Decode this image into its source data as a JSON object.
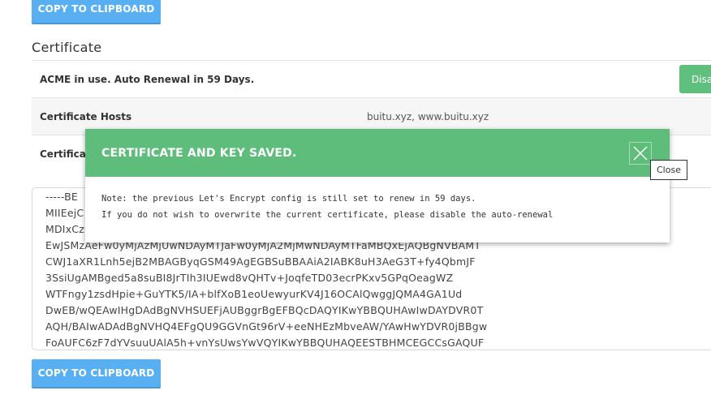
{
  "buttons": {
    "copy_top": "COPY TO CLIPBOARD",
    "copy_bottom": "COPY TO CLIPBOARD"
  },
  "certificate": {
    "section_title": "Certificate",
    "acme_status": "ACME in use. Auto Renewal in 59 Days.",
    "disable_button": "Disa",
    "hosts_label": "Certificate Hosts",
    "hosts_value": "buitu.xyz, www.buitu.xyz",
    "row3_label": "Certificat",
    "cert_lines": [
      "-----BE",
      "MIIEejC",
      "MDIxCz",
      "EwJSMzAeFw0yMjAzMjUwNDAyMTJaFw0yMjA2MjMwNDAyMTFaMBQxEjAQBgNVBAMT",
      "CWJ1aXR1Lnh5ejB2MBAGByqGSM49AgEGBSuBBAAiA2IABK8uH3AeG3T+fy4QbmJF",
      "3SsiUgAMBged5a8suBI8JrTIh3IUEwd8vQHTv+JoqfeTD03ecrPKxv5GPqOeagWZ",
      "WTFngy1zsdHpie+GuYTK5/IA+blfXoB1eoUewyurKV4J16OCAlQwggJQMA4GA1Ud",
      "DwEB/wQEAwIHgDAdBgNVHSUEFjAUBggrBgEFBQcDAQYIKwYBBQUHAwIwDAYDVR0T",
      "AQH/BAIwADAdBgNVHQ4EFgQU9GGVnGt96rV+eeNHEzMbveAW/YAwHwYDVR0jBBgw",
      "FoAUFC6zF7dYVsuuUAlA5h+vnYsUwsYwVQYIKwYBBQUHAQEESTBHMCEGCCsGAQUF"
    ]
  },
  "modal": {
    "title": "CERTIFICATE AND KEY SAVED.",
    "line1": "Note: the previous Let's Encrypt config is still set to renew in 59 days.",
    "line2": "If you do not wish to overwrite the current certificate, please disable the auto-renewal",
    "close_icon": "close-x-icon"
  },
  "tooltip": {
    "text": "Close"
  },
  "colors": {
    "accent_blue": "#58aff1",
    "success_green": "#5ebd7b"
  }
}
